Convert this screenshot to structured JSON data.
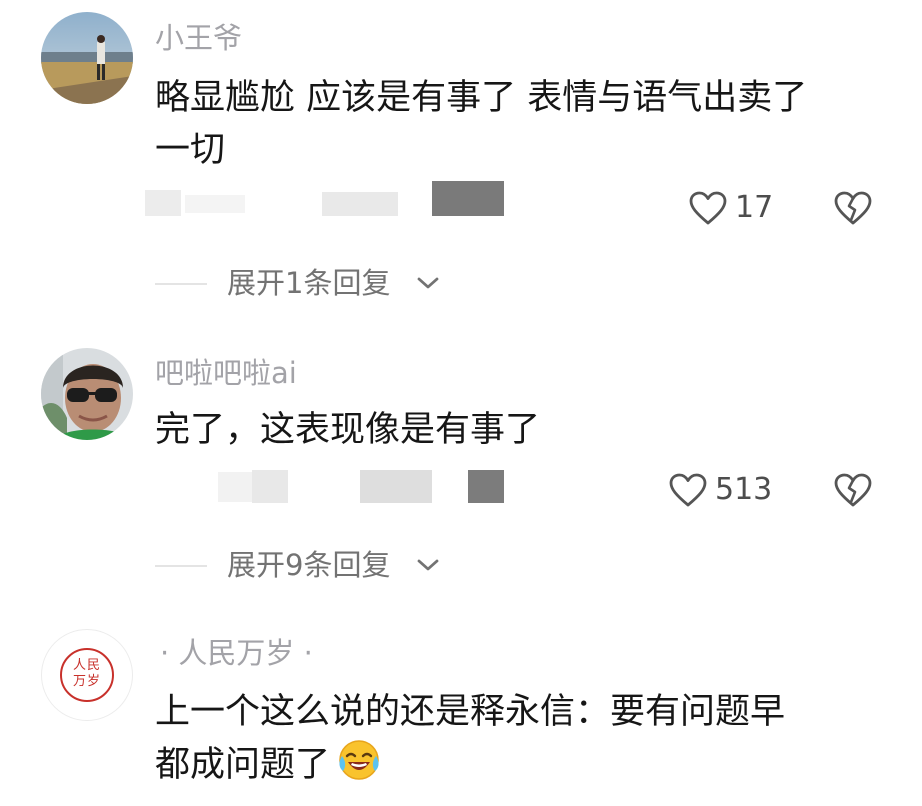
{
  "comments": [
    {
      "username": "小王爷",
      "text_lines": [
        "略显尴尬 应该是有事了 表情与语气出卖了",
        "一切"
      ],
      "likes": "17",
      "replies_label": "展开1条回复"
    },
    {
      "username": "吧啦吧啦ai",
      "text_lines": [
        "完了，这表现像是有事了"
      ],
      "likes": "513",
      "replies_label": "展开9条回复"
    },
    {
      "username": "· 人民万岁 ·",
      "avatar_text": "人民万岁",
      "text_lines": [
        "上一个这么说的还是释永信：要有问题早",
        "都成问题了"
      ],
      "emoji": "laugh-cry"
    }
  ],
  "colors": {
    "username": "#a3a3a8",
    "text": "#161616",
    "icon": "#555555",
    "seal_red": "#c8312b"
  }
}
